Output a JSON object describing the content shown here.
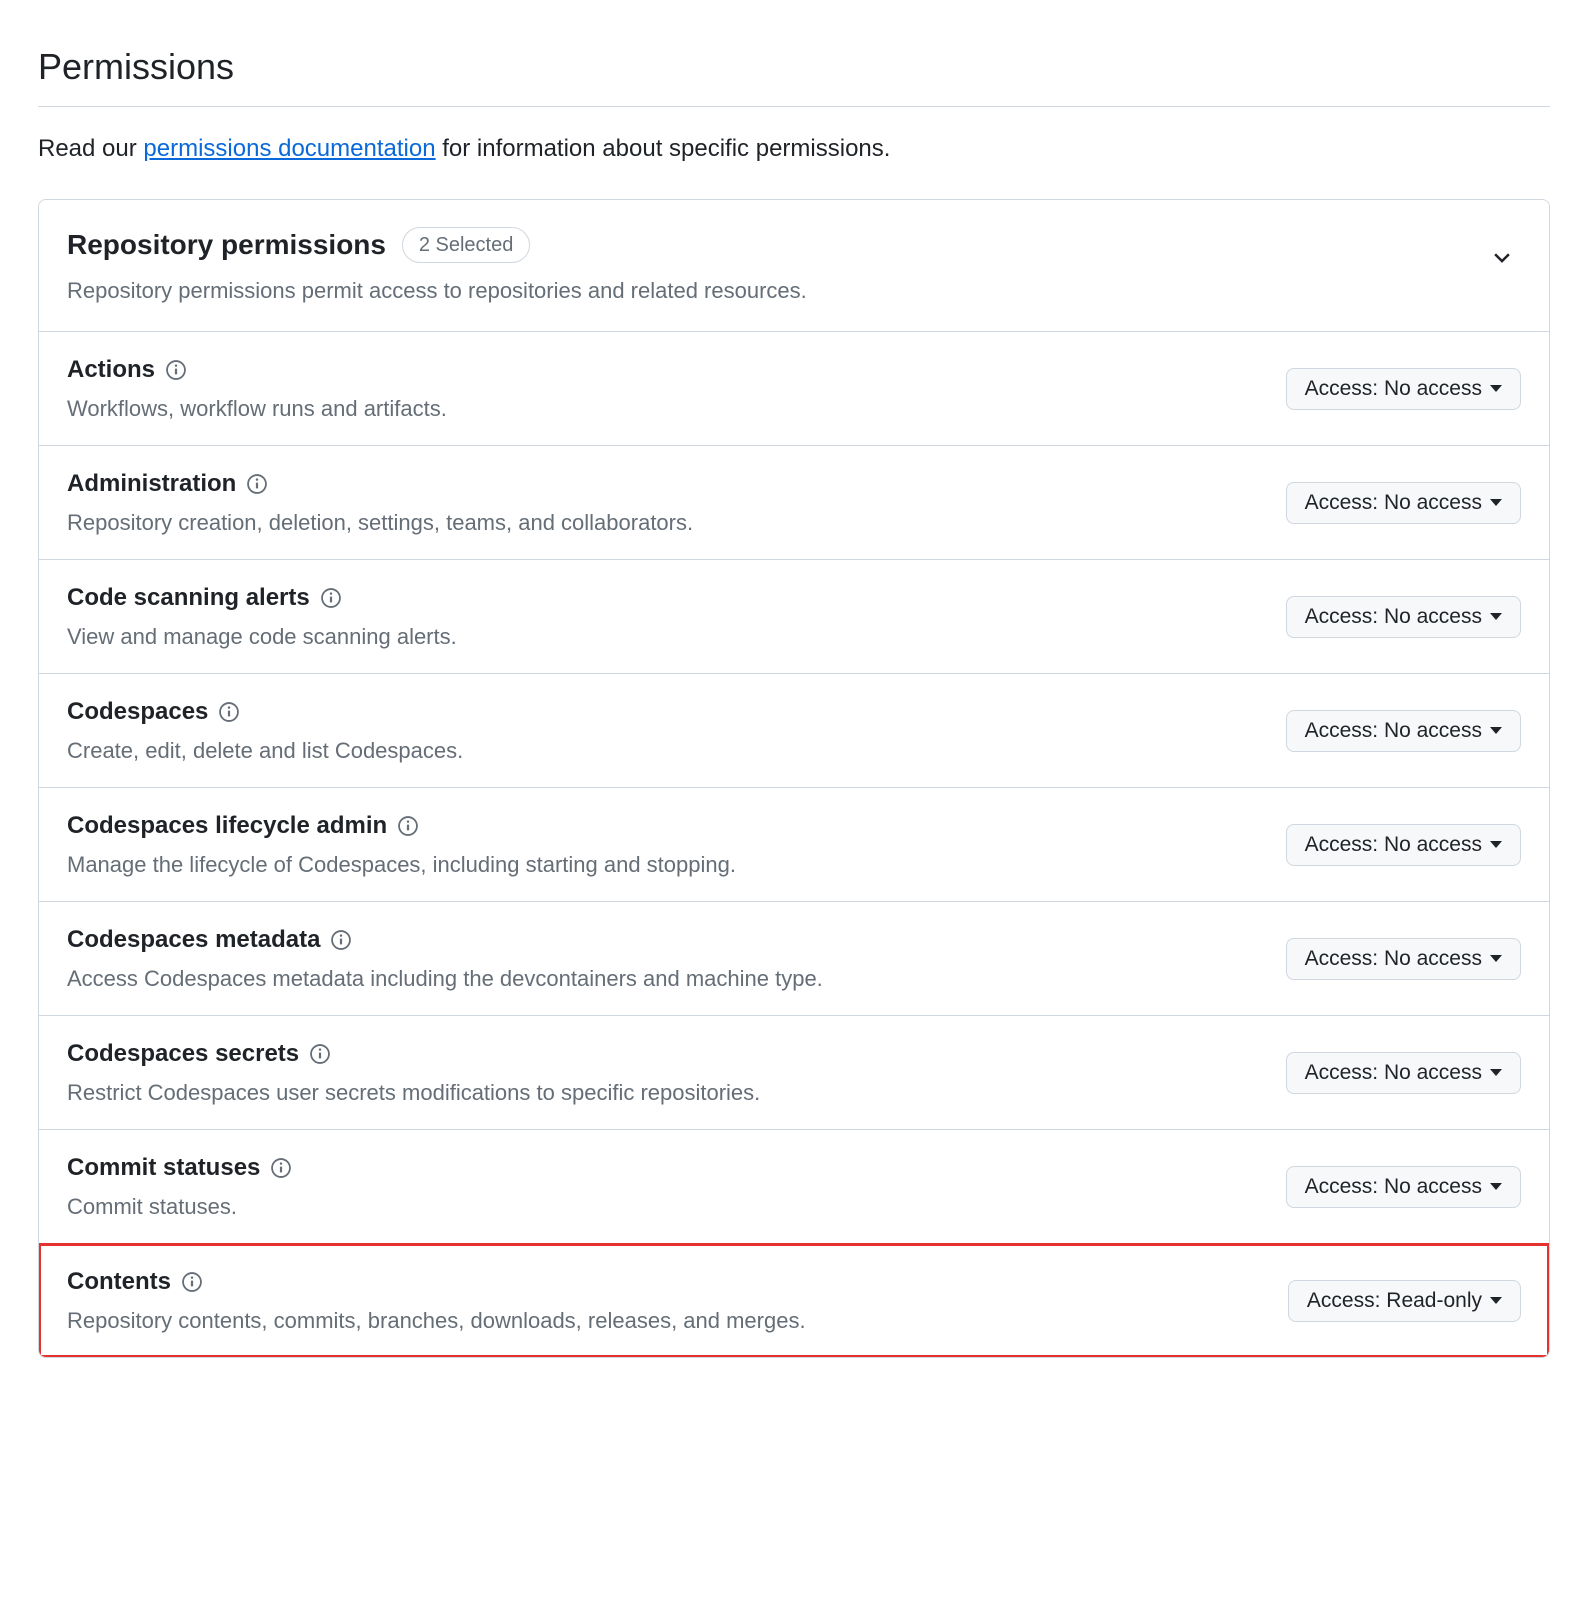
{
  "section_title": "Permissions",
  "intro_prefix": "Read our ",
  "intro_link": "permissions documentation",
  "intro_suffix": " for information about specific permissions.",
  "panel": {
    "title": "Repository permissions",
    "badge": "2 Selected",
    "description": "Repository permissions permit access to repositories and related resources."
  },
  "access_label_prefix": "Access: ",
  "permissions": [
    {
      "title": "Actions",
      "desc": "Workflows, workflow runs and artifacts.",
      "access": "No access",
      "highlight": false
    },
    {
      "title": "Administration",
      "desc": "Repository creation, deletion, settings, teams, and collaborators.",
      "access": "No access",
      "highlight": false
    },
    {
      "title": "Code scanning alerts",
      "desc": "View and manage code scanning alerts.",
      "access": "No access",
      "highlight": false
    },
    {
      "title": "Codespaces",
      "desc": "Create, edit, delete and list Codespaces.",
      "access": "No access",
      "highlight": false
    },
    {
      "title": "Codespaces lifecycle admin",
      "desc": "Manage the lifecycle of Codespaces, including starting and stopping.",
      "access": "No access",
      "highlight": false
    },
    {
      "title": "Codespaces metadata",
      "desc": "Access Codespaces metadata including the devcontainers and machine type.",
      "access": "No access",
      "highlight": false
    },
    {
      "title": "Codespaces secrets",
      "desc": "Restrict Codespaces user secrets modifications to specific repositories.",
      "access": "No access",
      "highlight": false
    },
    {
      "title": "Commit statuses",
      "desc": "Commit statuses.",
      "access": "No access",
      "highlight": false
    },
    {
      "title": "Contents",
      "desc": "Repository contents, commits, branches, downloads, releases, and merges.",
      "access": "Read-only",
      "highlight": true
    }
  ]
}
